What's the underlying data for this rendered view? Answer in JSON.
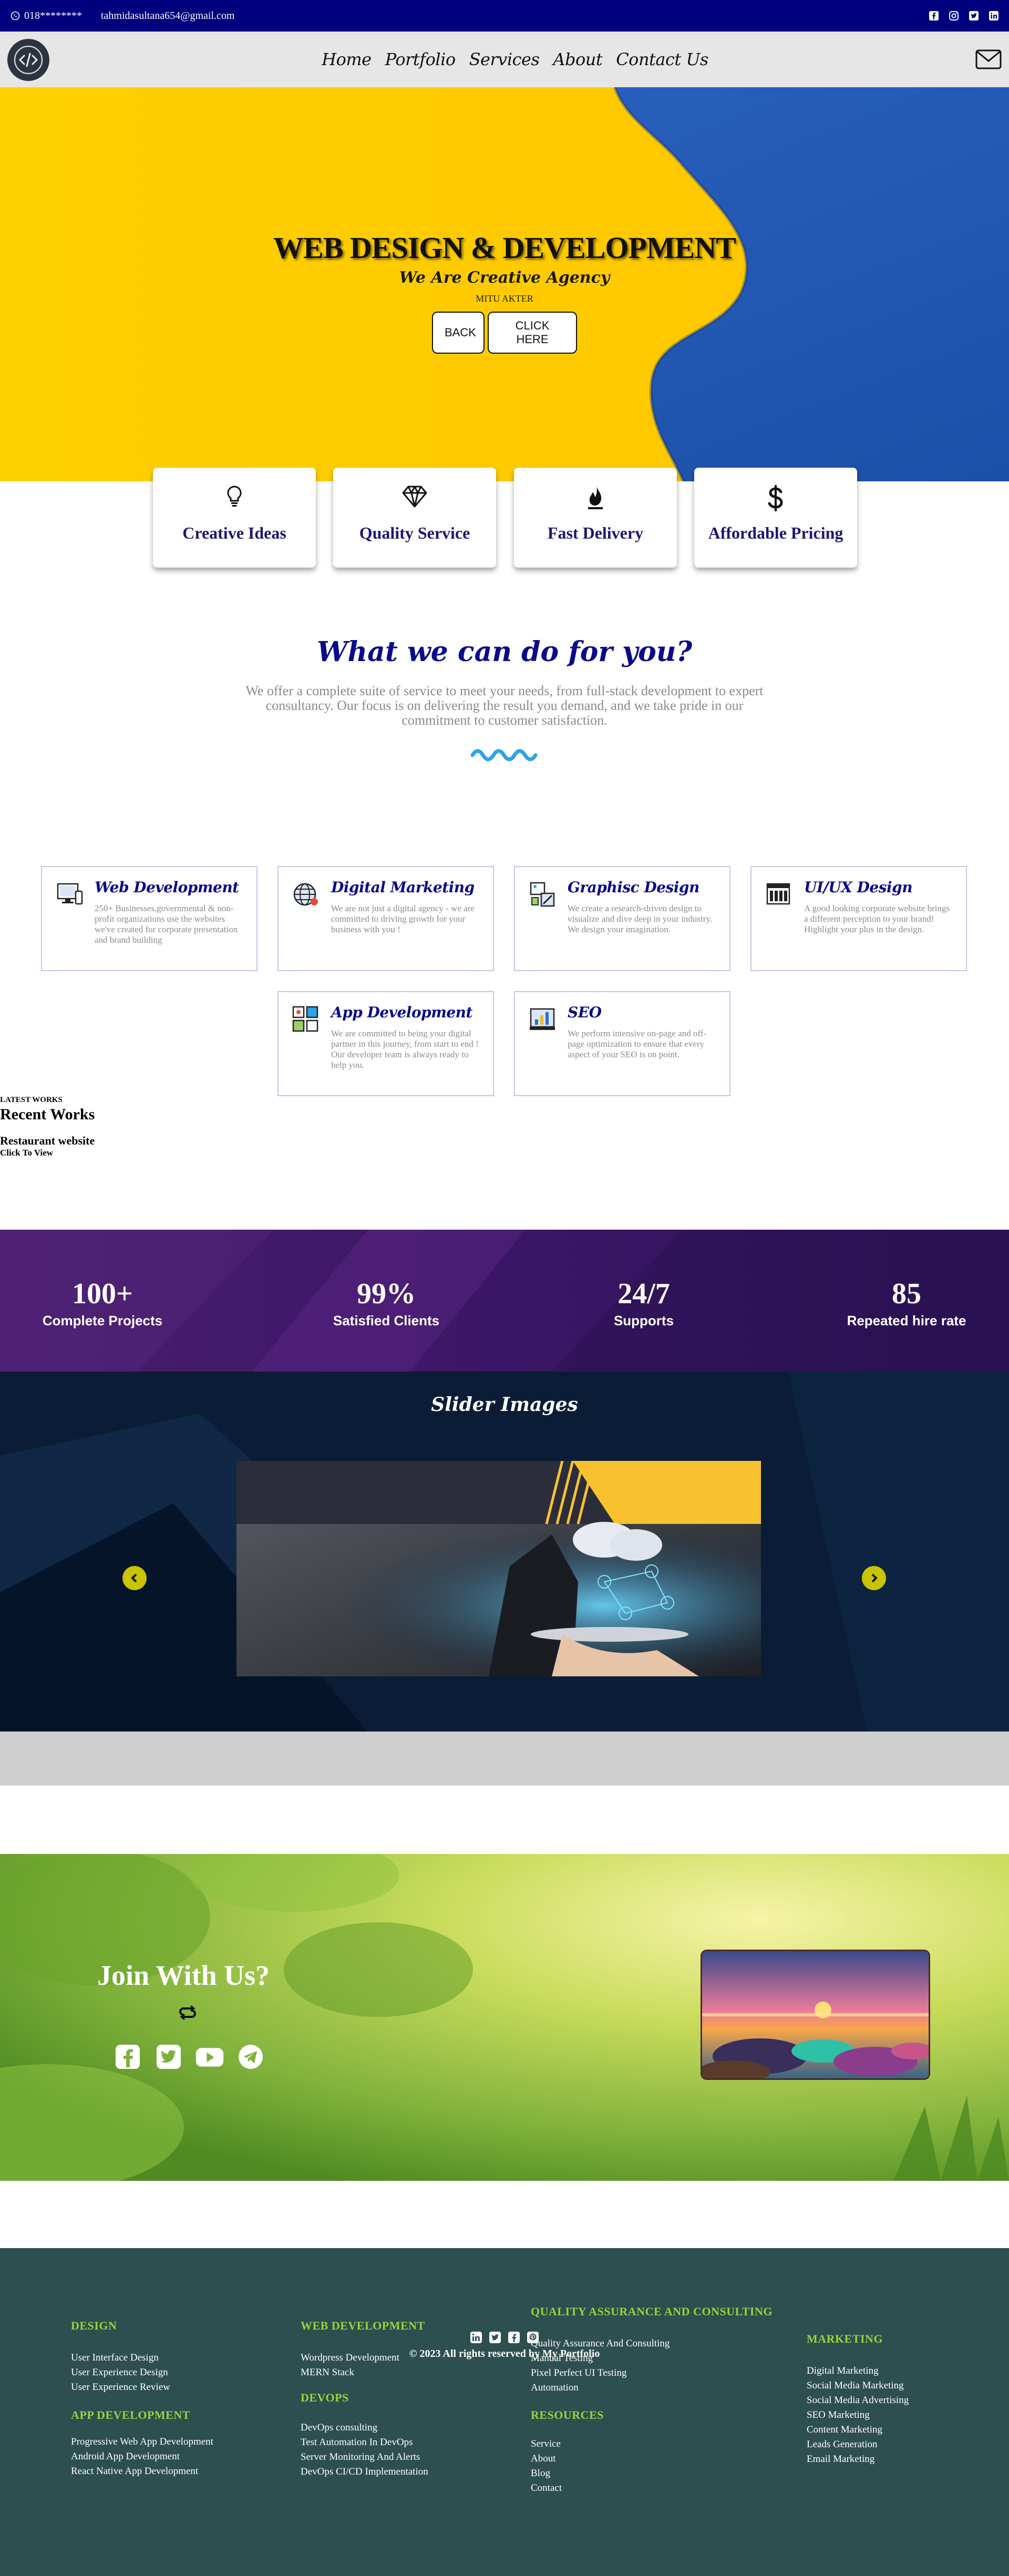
{
  "topbar": {
    "phone": "018********",
    "email": "tahmidasultana654@gmail.com",
    "social": [
      "facebook-icon",
      "instagram-icon",
      "twitter-icon",
      "linkedin-icon"
    ]
  },
  "nav": {
    "items": [
      "Home",
      "Portfolio",
      "Services",
      "About",
      "Contact Us"
    ]
  },
  "hero": {
    "title": "WEB DESIGN & DEVELOPMENT",
    "subtitle": "We Are Creative Agency",
    "name": "MITU AKTER",
    "back_label": "BACK",
    "click_label": "CLICK HERE",
    "colors": {
      "yellow": "#ffcc00",
      "blue": "#2158b6"
    }
  },
  "features": [
    {
      "label": "Creative Ideas",
      "icon": "lightbulb-icon"
    },
    {
      "label": "Quality Service",
      "icon": "diamond-icon"
    },
    {
      "label": "Fast Delivery",
      "icon": "fire-icon"
    },
    {
      "label": "Affordable Pricing",
      "icon": "dollar-icon"
    }
  ],
  "intro": {
    "title": "What we can do for you?",
    "text": "We offer a complete suite of service to meet your needs, from full-stack development to expert consultancy. Our focus is on delivering the result you demand, and we take pride in our commitment to customer satisfaction."
  },
  "services": [
    {
      "title": "Web Development",
      "icon": "desktop-icon",
      "text": "250+ Businesses,governmental & non-profit organizations use the websites we've created for corporate presentation and brand building"
    },
    {
      "title": "Digital Marketing",
      "icon": "globe-icon",
      "text": "We are not just a digital agency - we are committed to driving growth for your business with you !"
    },
    {
      "title": "Graphisc Design",
      "icon": "design-tools-icon",
      "text": "We create a research-driven design to visualize and dive deep in your industry. We design your imagination."
    },
    {
      "title": "UI/UX Design",
      "icon": "ui-layout-icon",
      "text": "A good looking corporate website brings a different perception to your brand! Highlight your plus in the design."
    },
    {
      "title": "App Development",
      "icon": "app-blocks-icon",
      "text": "We are committed to being your digital partner in this journey, from start to end ! Our developer team is always ready to help you."
    },
    {
      "title": "SEO",
      "icon": "seo-chart-icon",
      "text": "We perform intensive on-page and off-page optimization to ensure that every aspect of your SEO is on point."
    }
  ],
  "recent": {
    "kicker": "LATEST WORKS",
    "title": "Recent Works",
    "item": "Restaurant website",
    "click": "Click To View"
  },
  "stats": [
    {
      "value": "100+",
      "label": "Complete Projects"
    },
    {
      "value": "99%",
      "label": "Satisfied Clients"
    },
    {
      "value": "24/7",
      "label": "Supports"
    },
    {
      "value": "85",
      "label": "Repeated hire rate"
    }
  ],
  "slider": {
    "title": "Slider Images",
    "active_index": 0,
    "slide_count": 2
  },
  "join": {
    "title": "Join With Us?",
    "social": [
      "facebook-icon",
      "twitter-icon",
      "youtube-icon",
      "telegram-icon"
    ]
  },
  "footer": {
    "columns": [
      {
        "heading": "DESIGN",
        "items": [
          "User Interface Design",
          "User Experience Design",
          "User Experience Review"
        ]
      },
      {
        "heading": "APP DEVELOPMENT",
        "items": [
          "Progressive Web App Development",
          "Android App Development",
          "React Native App Development"
        ]
      },
      {
        "heading": "WEB DEVELOPMENT",
        "items": [
          "Wordpress Development",
          "MERN Stack"
        ]
      },
      {
        "heading": "DEVOPS",
        "items": [
          "DevOps consulting",
          "Test Automation In DevOps",
          "Server Monitoring And Alerts",
          "DevOps CI/CD Implementation"
        ]
      },
      {
        "heading": "QUALITY ASSURANCE AND CONSULTING",
        "items": [
          "Quality Assurance And Consulting",
          "Manual Testing",
          "Pixel Perfect UI Testing",
          "Automation"
        ]
      },
      {
        "heading": "RESOURCES",
        "items": [
          "Service",
          "About",
          "Blog",
          "Contact"
        ]
      },
      {
        "heading": "MARKETING",
        "items": [
          "Digital Marketing",
          "Social Media Marketing",
          "Social Media Advertising",
          "SEO Marketing",
          "Content Marketing",
          "Leads Generation",
          "Email Marketing"
        ]
      }
    ],
    "social": [
      "linkedin-icon",
      "twitter-icon",
      "facebook-icon",
      "pinterest-icon"
    ],
    "copyright": "© 2023 All rights reserved by My Portfolio"
  }
}
